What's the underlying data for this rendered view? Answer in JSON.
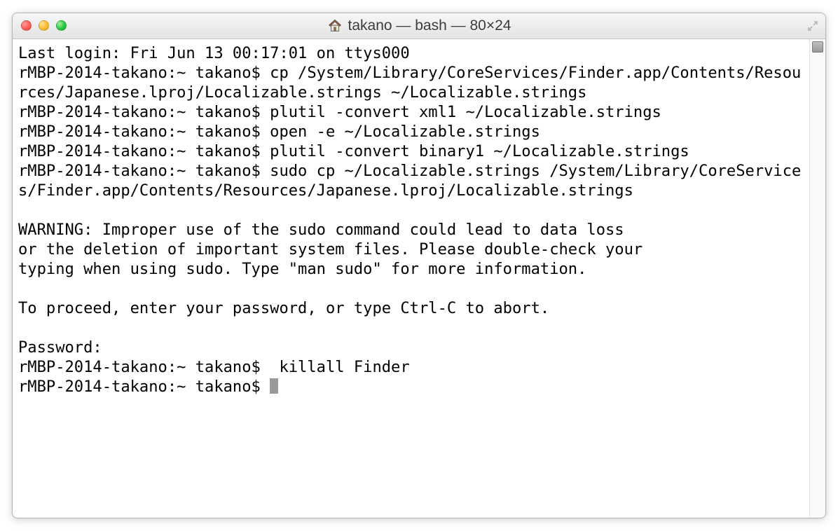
{
  "title": "takano — bash — 80×24",
  "prompt": "rMBP-2014-takano:~ takano$ ",
  "lines": {
    "l0": "Last login: Fri Jun 13 00:17:01 on ttys000",
    "l1": "rMBP-2014-takano:~ takano$ cp /System/Library/CoreServices/Finder.app/Contents/Resources/Japanese.lproj/Localizable.strings ~/Localizable.strings",
    "l2": "rMBP-2014-takano:~ takano$ plutil -convert xml1 ~/Localizable.strings",
    "l3": "rMBP-2014-takano:~ takano$ open -e ~/Localizable.strings",
    "l4": "rMBP-2014-takano:~ takano$ plutil -convert binary1 ~/Localizable.strings",
    "l5": "rMBP-2014-takano:~ takano$ sudo cp ~/Localizable.strings /System/Library/CoreServices/Finder.app/Contents/Resources/Japanese.lproj/Localizable.strings",
    "l6": "",
    "l7": "WARNING: Improper use of the sudo command could lead to data loss",
    "l8": "or the deletion of important system files. Please double-check your",
    "l9": "typing when using sudo. Type \"man sudo\" for more information.",
    "l10": "",
    "l11": "To proceed, enter your password, or type Ctrl-C to abort.",
    "l12": "",
    "l13": "Password:",
    "l14": "rMBP-2014-takano:~ takano$  killall Finder",
    "l15": "rMBP-2014-takano:~ takano$ "
  }
}
